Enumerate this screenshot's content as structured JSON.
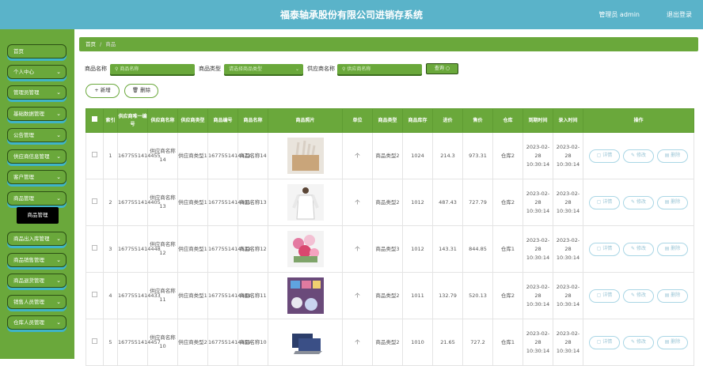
{
  "header": {
    "title": "福泰轴承股份有限公司进销存系统",
    "user": "管理员 admin",
    "logout": "退出登录"
  },
  "sidebar": {
    "items": [
      {
        "label": "首页",
        "chevron": false
      },
      {
        "label": "个人中心",
        "chevron": true
      },
      {
        "label": "管理员管理",
        "chevron": true
      },
      {
        "label": "基础数据管理",
        "chevron": true
      },
      {
        "label": "公告管理",
        "chevron": true
      },
      {
        "label": "供应商信息管理",
        "chevron": true
      },
      {
        "label": "客户管理",
        "chevron": true
      },
      {
        "label": "商品管理",
        "chevron": true
      },
      {
        "label": "商品出入库管理",
        "chevron": true
      },
      {
        "label": "商品销售管理",
        "chevron": true
      },
      {
        "label": "商品退货管理",
        "chevron": true
      },
      {
        "label": "销售人员管理",
        "chevron": true
      },
      {
        "label": "仓库人员管理",
        "chevron": true
      }
    ],
    "submenu": "商品管理"
  },
  "breadcrumb": {
    "home": "首页",
    "sep": "/",
    "current": "商品"
  },
  "search": {
    "name_label": "商品名称",
    "name_placeholder": "商品名称",
    "type_label": "商品类型",
    "type_placeholder": "请选择商品类型",
    "supplier_label": "供应商名称",
    "supplier_placeholder": "供应商名称",
    "query_button": "查询"
  },
  "actions": {
    "add": "新增",
    "delete": "删除"
  },
  "table": {
    "headers": [
      "",
      "索引",
      "供应商唯一编号",
      "供应商名称",
      "供应商类型",
      "商品编号",
      "商品名称",
      "商品照片",
      "单位",
      "商品类型",
      "商品库存",
      "进价",
      "售价",
      "仓库",
      "到期时间",
      "录入时间",
      "操作"
    ],
    "rows": [
      {
        "index": "1",
        "supplier_id": "1677551414455",
        "supplier_name": "供应商名称14",
        "supplier_type": "供应商类型1",
        "goods_id": "1677551414473",
        "goods_name": "商品名称14",
        "unit": "个",
        "goods_type": "商品类型2",
        "stock": "1024",
        "cost": "214.3",
        "price": "973.31",
        "warehouse": "仓库2",
        "expire": "2023-02-28 10:30:14",
        "created": "2023-02-28 10:30:14",
        "pic": "bag"
      },
      {
        "index": "2",
        "supplier_id": "1677551414405",
        "supplier_name": "供应商名称13",
        "supplier_type": "供应商类型1",
        "goods_id": "1677551414491",
        "goods_name": "商品名称13",
        "unit": "个",
        "goods_type": "商品类型2",
        "stock": "1012",
        "cost": "487.43",
        "price": "727.79",
        "warehouse": "仓库2",
        "expire": "2023-02-28 10:30:14",
        "created": "2023-02-28 10:30:14",
        "pic": "shirt"
      },
      {
        "index": "3",
        "supplier_id": "1677551414448",
        "supplier_name": "供应商名称12",
        "supplier_type": "供应商类型1",
        "goods_id": "1677551414533",
        "goods_name": "商品名称12",
        "unit": "个",
        "goods_type": "商品类型3",
        "stock": "1012",
        "cost": "143.31",
        "price": "844.85",
        "warehouse": "仓库1",
        "expire": "2023-02-28 10:30:14",
        "created": "2023-02-28 10:30:14",
        "pic": "flowers"
      },
      {
        "index": "4",
        "supplier_id": "1677551414433",
        "supplier_name": "供应商名称11",
        "supplier_type": "供应商类型1",
        "goods_id": "1677551414484",
        "goods_name": "商品名称11",
        "unit": "个",
        "goods_type": "商品类型2",
        "stock": "1011",
        "cost": "132.79",
        "price": "520.13",
        "warehouse": "仓库2",
        "expire": "2023-02-28 10:30:14",
        "created": "2023-02-28 10:30:14",
        "pic": "room"
      },
      {
        "index": "5",
        "supplier_id": "1677551414457",
        "supplier_name": "供应商名称10",
        "supplier_type": "供应商类型2",
        "goods_id": "1677551414459",
        "goods_name": "商品名称10",
        "unit": "个",
        "goods_type": "商品类型2",
        "stock": "1010",
        "cost": "21.65",
        "price": "727.2",
        "warehouse": "仓库1",
        "expire": "2023-02-28 10:30:14",
        "created": "2023-02-28 10:30:14",
        "pic": "laptop"
      }
    ],
    "op_labels": {
      "detail": "详情",
      "edit": "修改",
      "delete": "删除"
    }
  },
  "colors": {
    "header": "#5ab3c9",
    "primary": "#6aa83b",
    "accent": "#3fb4c8"
  }
}
